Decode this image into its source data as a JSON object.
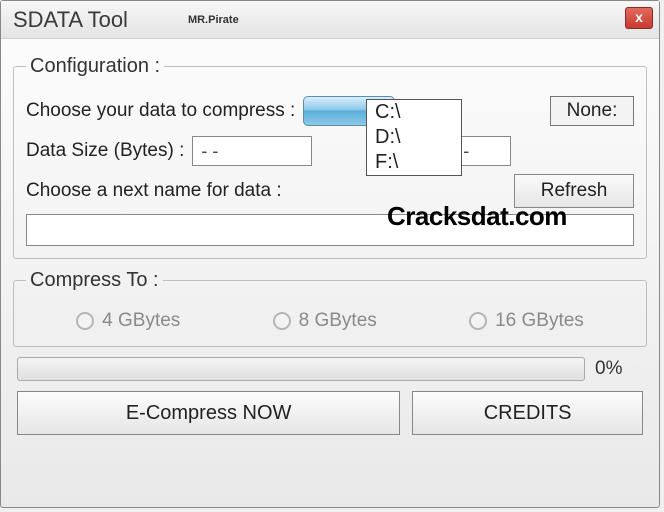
{
  "window": {
    "title": "SDATA Tool",
    "subtitle": "MR.Pirate",
    "close_icon": "x"
  },
  "config": {
    "legend": "Configuration :",
    "choose_label": "Choose your data to compress :",
    "none_label": "None:",
    "data_size_label": "Data Size (Bytes) :",
    "data_size_value": "- -",
    "right_paren_label": ") :",
    "right_value": "- -",
    "next_name_label": "Choose a next name for data :",
    "refresh_label": "Refresh",
    "dropdown_options": [
      "C:\\",
      "D:\\",
      "F:\\"
    ]
  },
  "compress": {
    "legend": "Compress To :",
    "options": [
      "4 GBytes",
      "8 GBytes",
      "16 GBytes"
    ]
  },
  "progress": {
    "percent_label": "0%"
  },
  "buttons": {
    "ecompress": "E-Compress NOW",
    "credits": "CREDITS"
  },
  "watermark": "Cracksdat.com"
}
